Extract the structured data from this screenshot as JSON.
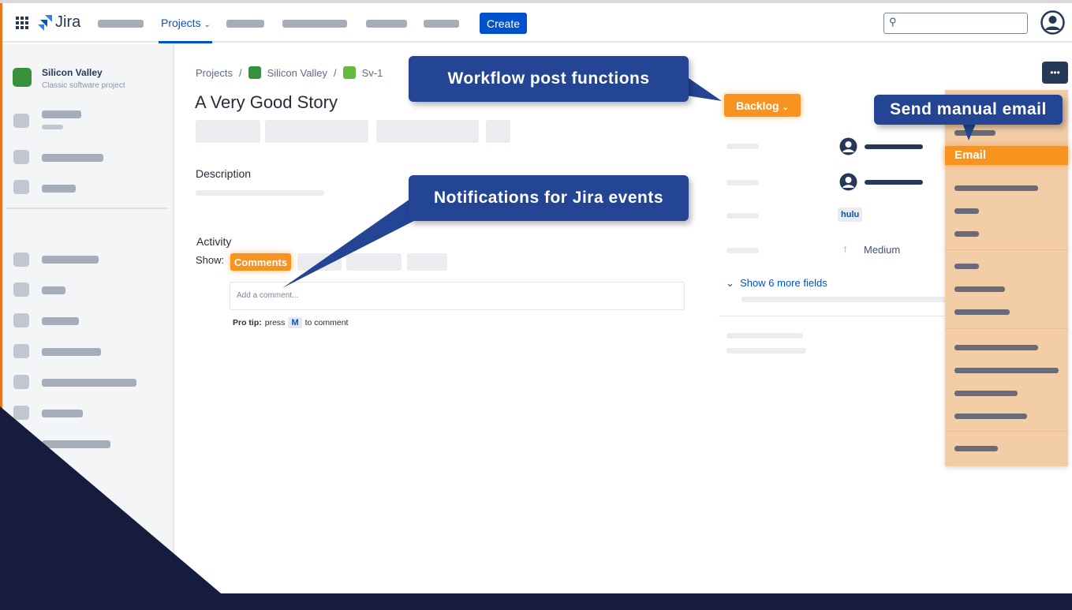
{
  "nav": {
    "logo": "Jira",
    "projects": "Projects",
    "create": "Create",
    "search_placeholder": ""
  },
  "sidebar": {
    "project_name": "Silicon Valley",
    "project_type": "Classic software project"
  },
  "breadcrumb": {
    "root": "Projects",
    "project": "Silicon Valley",
    "issue": "Sv-1",
    "sep": "/"
  },
  "issue": {
    "title": "A Very Good Story",
    "description_label": "Description",
    "activity_label": "Activity",
    "show_label": "Show:",
    "comments_tab": "Comments",
    "comment_placeholder": "Add a comment...",
    "pro_tip_bold": "Pro tip:",
    "pro_tip_press": "press",
    "pro_tip_key": "M",
    "pro_tip_end": "to comment"
  },
  "details": {
    "status": "Backlog",
    "label": "hulu",
    "priority": "Medium",
    "show_more": "Show 6 more fields"
  },
  "menu": {
    "email": "Email",
    "more": "•••"
  },
  "callouts": {
    "workflow": "Workflow post functions",
    "notifications": "Notifications for Jira events",
    "manual_email": "Send manual email"
  },
  "colors": {
    "accent": "#0052cc",
    "orange": "#f7931e",
    "callout": "#234594",
    "navy": "#151c3e"
  }
}
